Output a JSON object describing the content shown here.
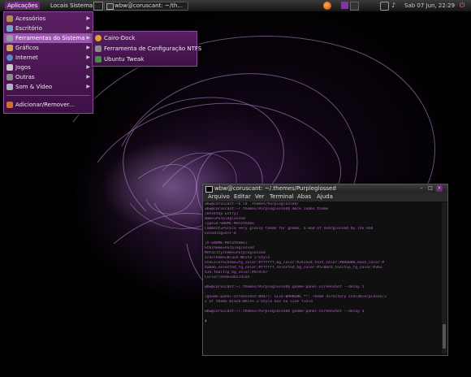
{
  "colors": {
    "accent": "#6a2a78",
    "menu_bg": "#4a1553",
    "highlight": "#9d56b0",
    "terminal_text": "#c25ad6",
    "terminal_bg": "#101010"
  },
  "top_panel": {
    "apps_label": "Aplicações",
    "places_label": "Locais",
    "system_label": "Sistema",
    "taskbar_window": "wbw@coruscant: ~/th...",
    "clock": "Sab 07 Jun, 22:29",
    "tray_icons": [
      "firefox-icon",
      "workspace-icon",
      "workspace-icon",
      "network-icon",
      "volume-icon",
      "power-icon"
    ]
  },
  "main_menu": {
    "items": [
      {
        "label": "Acessórios",
        "icon": "accessories-icon",
        "submenu": true
      },
      {
        "label": "Escritório",
        "icon": "office-icon",
        "submenu": true
      },
      {
        "label": "Ferramentas do Sistema",
        "icon": "system-tools-icon",
        "submenu": true
      },
      {
        "label": "Gráficos",
        "icon": "graphics-icon",
        "submenu": true
      },
      {
        "label": "Internet",
        "icon": "internet-icon",
        "submenu": true
      },
      {
        "label": "Jogos",
        "icon": "games-icon",
        "submenu": true
      },
      {
        "label": "Outras",
        "icon": "other-icon",
        "submenu": true
      },
      {
        "label": "Som & Vídeo",
        "icon": "sound-video-icon",
        "submenu": true
      },
      {
        "label": "Adicionar/Remover...",
        "icon": "add-remove-icon",
        "submenu": false
      }
    ]
  },
  "sub_menu": {
    "items": [
      {
        "label": "Cairo-Dock",
        "icon": "cairo-dock-icon"
      },
      {
        "label": "Ferramenta de Configuração NTFS",
        "icon": "ntfs-config-icon"
      },
      {
        "label": "Ubuntu Tweak",
        "icon": "ubuntu-tweak-icon"
      }
    ]
  },
  "terminal": {
    "title": "wbw@coruscant: ~/.themes/Purpleglossed",
    "menu": [
      "Arquivo",
      "Editar",
      "Ver",
      "Terminal",
      "Abas",
      "Ajuda"
    ],
    "lines": [
      "wbw@coruscant:~$ cd .themes/Purpleglossed/",
      "wbw@coruscant:~/.themes/Purpleglossed$ more index.theme",
      "[Desktop Entry]",
      "Name=Purpleglossed",
      "Type=X-GNOME-Metatheme",
      "Comment=Purple very glossy theme for gnome, a mod of Overglossed by The Rob",
      "Encoding=UTF-8",
      "",
      "[X-GNOME-Metatheme]",
      "GtkTheme=Purpleglossed",
      "MetacityTheme=Purpleglossed",
      "IconTheme=Black-White 2-Style",
      "GtkColorScheme=fg_color:#ffffff,bg_color:#242424,text_color:#000000,base_color:#",
      "babab,selected_fg_color:#ffffff,selected_bg_color:#5c00c9,tooltip_fg_color:#363",
      "434,tooltip_bg_color:#d7d7d7",
      "CursorTheme=Obsidian",
      "",
      "wbw@coruscant:~/.themes/Purpleglossed$ gnome-panel-screenshot --delay 5",
      "",
      "(gnome-panel-screenshot:8047): GLib-WARNING **: Theme directory scalable/places/2",
      "2 of theme Black-White 2-Style has no size field",
      "",
      "wbw@coruscant:~/.themes/Purpleglossed$ gnome-panel-screenshot --delay 3",
      "",
      "▮"
    ]
  }
}
